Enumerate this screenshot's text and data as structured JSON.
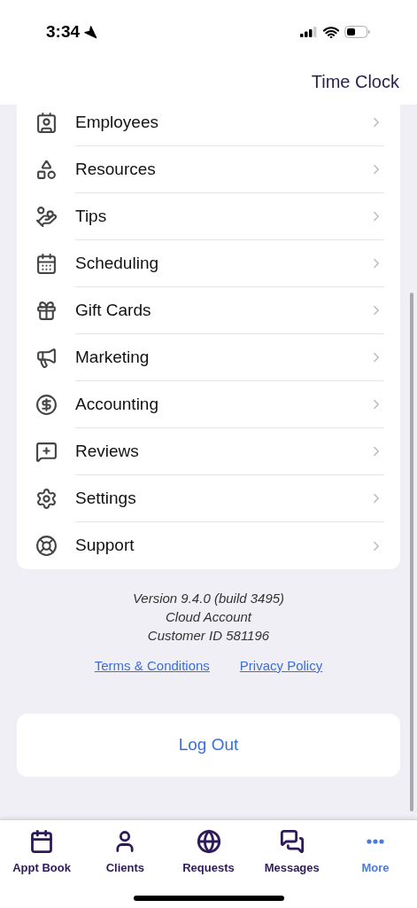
{
  "status_bar": {
    "time": "3:34"
  },
  "header": {
    "action": "Time Clock"
  },
  "menu": [
    {
      "label": "Employees"
    },
    {
      "label": "Resources"
    },
    {
      "label": "Tips"
    },
    {
      "label": "Scheduling"
    },
    {
      "label": "Gift Cards"
    },
    {
      "label": "Marketing"
    },
    {
      "label": "Accounting"
    },
    {
      "label": "Reviews"
    },
    {
      "label": "Settings"
    },
    {
      "label": "Support"
    }
  ],
  "info": [
    "Version 9.4.0 (build 3495)",
    "Cloud Account",
    "Customer ID 581196"
  ],
  "links": [
    "Terms & Conditions",
    "Privacy Policy"
  ],
  "logout": "Log Out",
  "tabs": [
    {
      "label": "Appt Book",
      "selected": false
    },
    {
      "label": "Clients",
      "selected": false
    },
    {
      "label": "Requests",
      "selected": false
    },
    {
      "label": "Messages",
      "selected": false
    },
    {
      "label": "More",
      "selected": true
    }
  ]
}
